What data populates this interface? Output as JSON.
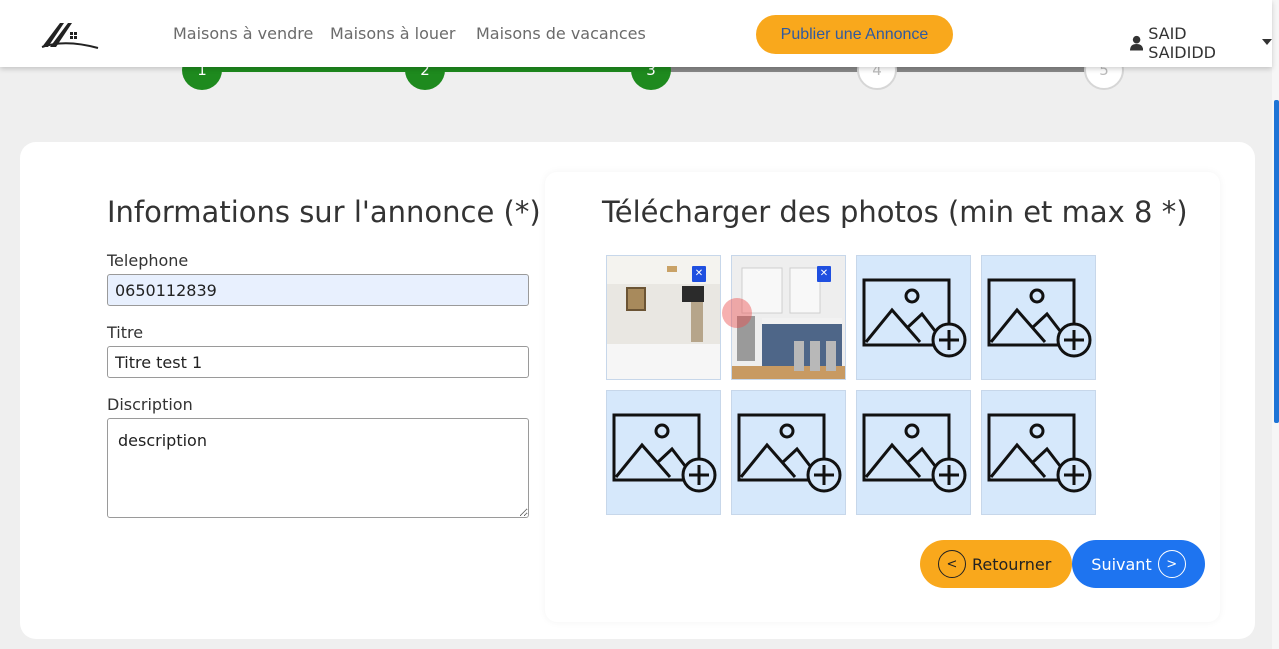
{
  "header": {
    "nav": [
      "Maisons à vendre",
      "Maisons à louer",
      "Maisons de vacances"
    ],
    "publish_label": "Publier une Annonce",
    "user_name": "SAID SAIDIDD"
  },
  "stepper": {
    "steps": [
      "1",
      "2",
      "3",
      "4",
      "5"
    ],
    "current_step": 3,
    "done_color": "#1e8a1e"
  },
  "form": {
    "title": "Informations sur l'annonce (*)",
    "telephone_label": "Telephone",
    "telephone_value": "0650112839",
    "titre_label": "Titre",
    "titre_value": "Titre test 1",
    "description_label": "Discription",
    "description_value": "description"
  },
  "photos": {
    "title": "Télécharger des photos (min et max 8 *)",
    "slots": [
      {
        "state": "uploaded",
        "subject": "bedroom"
      },
      {
        "state": "uploaded",
        "subject": "kitchen"
      },
      {
        "state": "empty"
      },
      {
        "state": "empty"
      },
      {
        "state": "empty"
      },
      {
        "state": "empty"
      },
      {
        "state": "empty"
      },
      {
        "state": "empty"
      }
    ]
  },
  "actions": {
    "prev_label": "Retourner",
    "next_label": "Suivant"
  },
  "colors": {
    "accent_orange": "#f9a81c",
    "accent_blue": "#1e74f0",
    "slot_bg": "#d6e8fb"
  }
}
